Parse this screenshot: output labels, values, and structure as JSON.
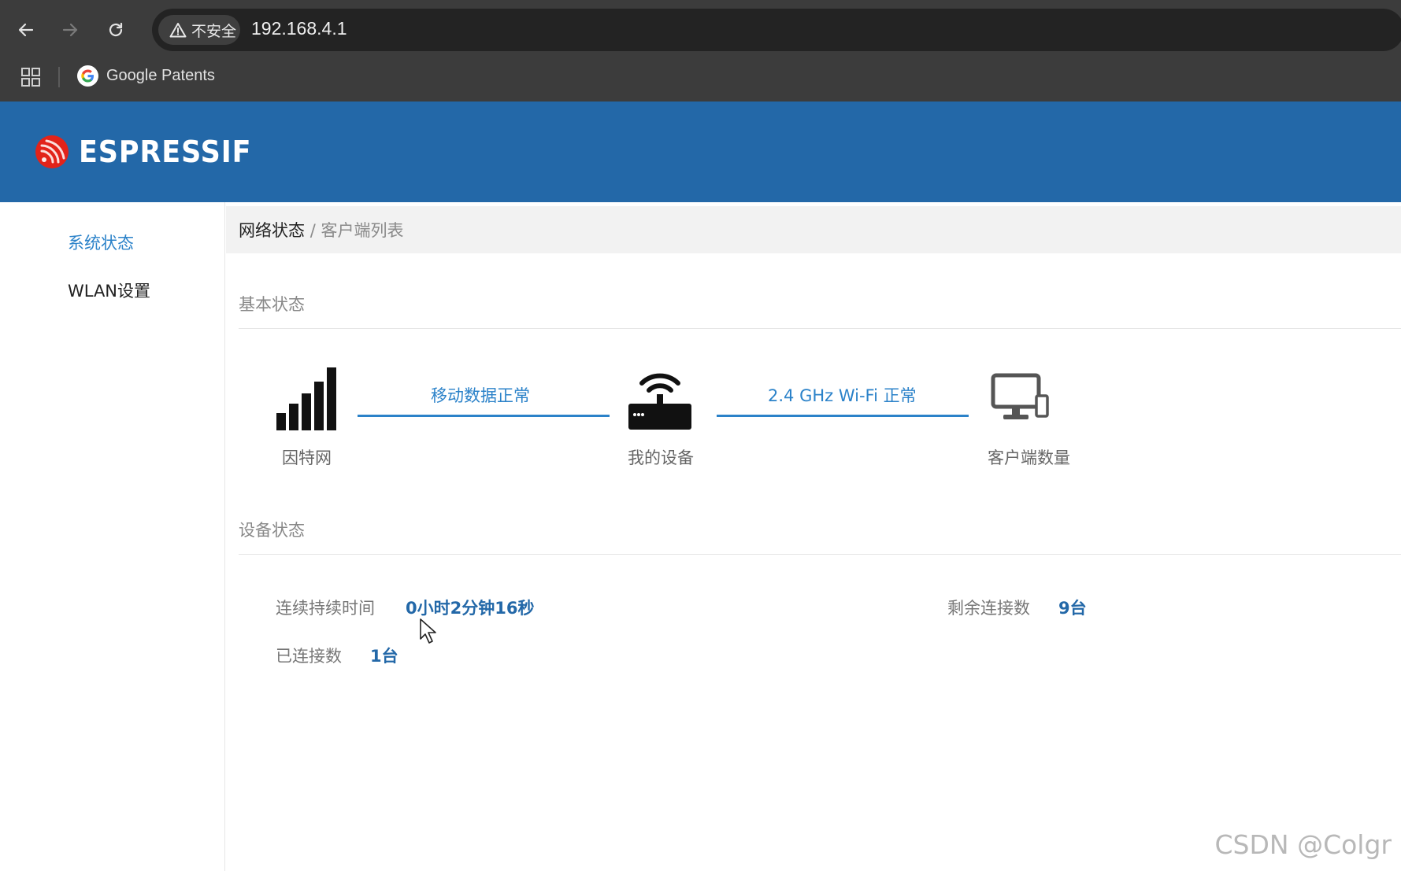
{
  "browser": {
    "security_label": "不安全",
    "url": "192.168.4.1",
    "bookmarks": [
      {
        "label": "Google Patents",
        "icon": "google-icon"
      }
    ]
  },
  "app": {
    "brand": "ESPRESSIF",
    "accent_color": "#2368a8"
  },
  "sidebar": {
    "items": [
      {
        "label": "系统状态",
        "active": true
      },
      {
        "label": "WLAN设置",
        "active": false
      }
    ]
  },
  "breadcrumb": {
    "current": "网络状态",
    "separator": "/",
    "sub": "客户端列表"
  },
  "basic_status": {
    "title": "基本状态",
    "nodes": [
      {
        "label": "因特网",
        "icon": "signal-bars-icon"
      },
      {
        "label": "我的设备",
        "icon": "router-icon"
      },
      {
        "label": "客户端数量",
        "icon": "devices-icon"
      }
    ],
    "links": [
      {
        "label": "移动数据正常"
      },
      {
        "label": "2.4 GHz Wi-Fi 正常"
      }
    ]
  },
  "device_status": {
    "title": "设备状态",
    "uptime_label": "连续持续时间",
    "uptime_value": "0小时2分钟16秒",
    "remaining_label": "剩余连接数",
    "remaining_value": "9台",
    "connected_label": "已连接数",
    "connected_value": "1台"
  },
  "watermark": "CSDN @Colgr"
}
